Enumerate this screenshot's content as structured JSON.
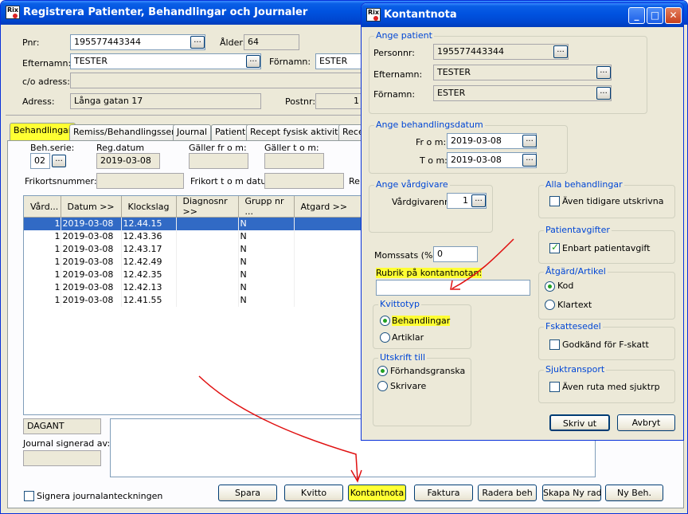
{
  "main": {
    "title": "Registrera Patienter, Behandlingar och Journaler",
    "icon": "rix-app-icon",
    "pnr_label": "Pnr:",
    "pnr": "195577443344",
    "alder_label": "Ålder:",
    "alder": "64",
    "efternamn_label": "Efternamn:",
    "efternamn": "TESTER",
    "fornamn_label": "Förnamn:",
    "fornamn": "ESTER",
    "co_label": "c/o adress:",
    "co": "",
    "adress_label": "Adress:",
    "adress": "Långa gatan 17",
    "postnr_label": "Postnr:",
    "postnr": "1",
    "tabs": [
      "Behandlingar",
      "Remiss/Behandlingsserie",
      "Journal",
      "Patient",
      "Recept fysisk aktivitet",
      "Rece"
    ],
    "behserie_label": "Beh.serie:",
    "behserie": "02",
    "regdatum_label": "Reg.datum",
    "regdatum": "2019-03-08",
    "galler_from_label": "Gäller fr o m:",
    "galler_tom_label": "Gäller t o m:",
    "frikort_label": "Frikortsnummer:",
    "frikort_tom_label": "Frikort t o m datum:",
    "re_label": "Re",
    "columns": [
      "Vård...",
      "Datum >>",
      "Klockslag",
      "Diagnosnr >>",
      "Grupp nr ...",
      "Atgard >>"
    ],
    "rows": [
      [
        "1",
        "2019-03-08",
        "12.44.15",
        "",
        "N",
        ""
      ],
      [
        "1",
        "2019-03-08",
        "12.43.36",
        "",
        "N",
        ""
      ],
      [
        "1",
        "2019-03-08",
        "12.43.17",
        "",
        "N",
        ""
      ],
      [
        "1",
        "2019-03-08",
        "12.42.49",
        "",
        "N",
        ""
      ],
      [
        "1",
        "2019-03-08",
        "12.42.35",
        "",
        "N",
        ""
      ],
      [
        "1",
        "2019-03-08",
        "12.42.13",
        "",
        "N",
        ""
      ],
      [
        "1",
        "2019-03-08",
        "12.41.55",
        "",
        "N",
        ""
      ]
    ],
    "dagant": "DAGANT",
    "signerad_label": "Journal signerad av:",
    "signera_label": "Signera journalanteckningen",
    "buttons": {
      "spara": "Spara",
      "kvitto": "Kvitto",
      "kontantnota": "Kontantnota",
      "faktura": "Faktura",
      "radera": "Radera beh",
      "skapa": "Skapa Ny rad",
      "ny": "Ny Beh."
    }
  },
  "dialog": {
    "title": "Kontantnota",
    "patient_group": "Ange patient",
    "personnr_label": "Personnr:",
    "personnr": "195577443344",
    "efternamn_label": "Efternamn:",
    "efternamn": "TESTER",
    "fornamn_label": "Förnamn:",
    "fornamn": "ESTER",
    "datum_group": "Ange behandlingsdatum",
    "from_label": "Fr o m:",
    "from": "2019-03-08",
    "tom_label": "T o m:",
    "tom": "2019-03-08",
    "vardgivare_group": "Ange vårdgivare",
    "vardgivarenr_label": "Vårdgivarenr:",
    "vardgivarenr": "1",
    "alla_group": "Alla behandlingar",
    "aven_tidigare": "Även tidigare utskrivna",
    "patientavgifter_group": "Patientavgifter",
    "enbart": "Enbart patientavgift",
    "momssats_label": "Momssats (%):",
    "momssats": "0",
    "rubrik_label": "Rubrik på kontantnotan:",
    "rubrik": "",
    "atgard_group": "Åtgärd/Artikel",
    "kod": "Kod",
    "klartext": "Klartext",
    "kvittotyp_group": "Kvittotyp",
    "behandlingar": "Behandlingar",
    "artiklar": "Artiklar",
    "fskatt_group": "Fskattesedel",
    "godkand": "Godkänd för F-skatt",
    "utskrift_group": "Utskrift till",
    "forhand": "Förhandsgranska",
    "skrivare": "Skrivare",
    "sjuk_group": "Sjuktransport",
    "aven_ruta": "Även ruta med sjuktrp",
    "skriv_ut": "Skriv ut",
    "avbryt": "Avbryt"
  },
  "colors": {
    "selection": "#316ac5",
    "highlight": "#ffff33",
    "annotation": "#e01010",
    "groupTitle": "#0046d5"
  }
}
